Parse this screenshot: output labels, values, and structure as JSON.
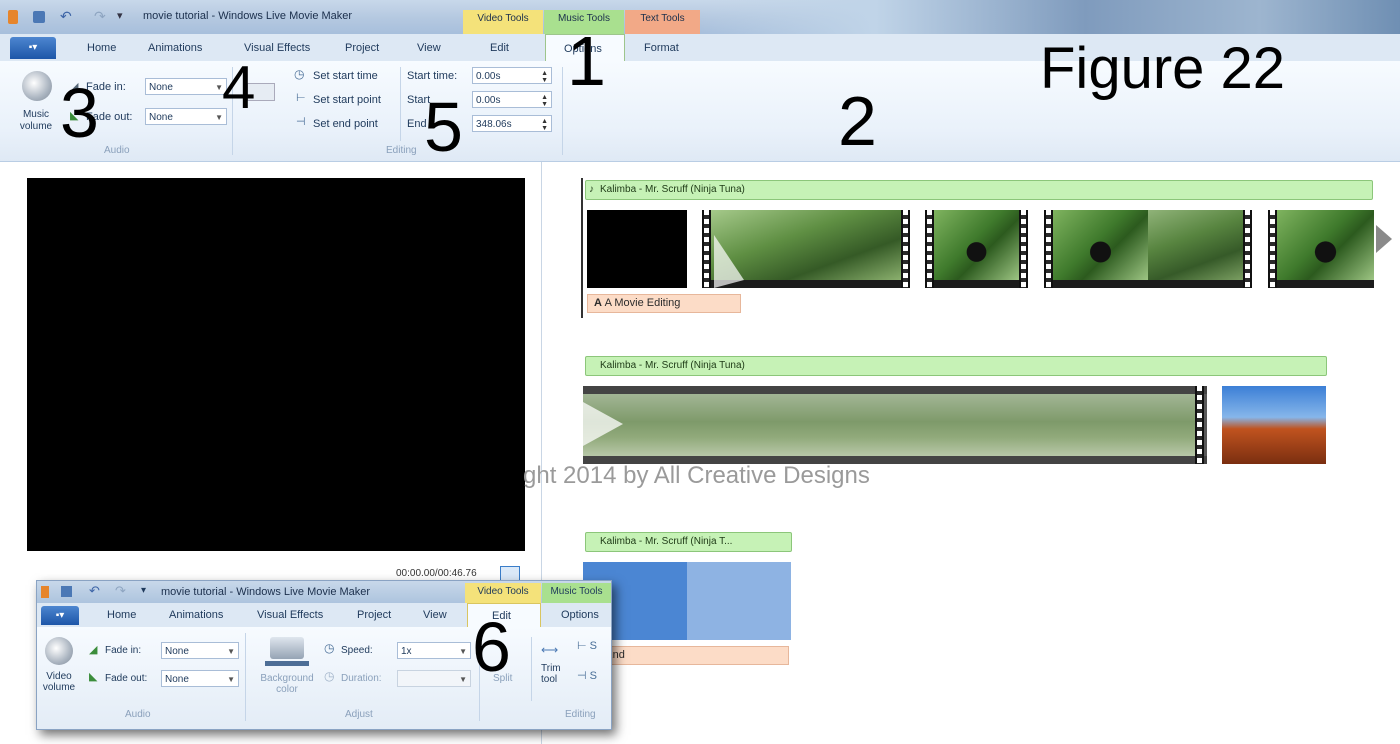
{
  "window": {
    "title": "movie tutorial - Windows Live Movie Maker",
    "context_tabs": {
      "video_tools": "Video Tools",
      "music_tools": "Music Tools",
      "text_tools": "Text Tools"
    }
  },
  "ribbon_tabs": [
    "Home",
    "Animations",
    "Visual Effects",
    "Project",
    "View",
    "Edit",
    "Options",
    "Format"
  ],
  "file_button": "▪▾",
  "audio_group": {
    "music_volume_label": "Music volume",
    "fade_in_label": "Fade in:",
    "fade_in_value": "None",
    "fade_out_label": "Fade out:",
    "fade_out_value": "None",
    "group_label": "Audio"
  },
  "editing_group": {
    "set_start_time": "Set start time",
    "set_start_point": "Set start point",
    "set_end_point": "Set end point",
    "start_time_label": "Start time:",
    "start_time_value": "0.00s",
    "start_point_label": "Start",
    "start_point_value": "0.00s",
    "end_point_label": "End",
    "end_point_value": "348.06s",
    "group_label": "Editing"
  },
  "callouts": {
    "c1": "1",
    "c2": "2",
    "c3": "3",
    "c4": "4",
    "c5": "5",
    "c6": "6"
  },
  "figure_label": "Figure 22",
  "watermark": "ght 2014 by All Creative Designs",
  "preview": {
    "timecode": "00:00.00/00:46.76"
  },
  "timeline": {
    "music1": "Kalimba - Mr. Scruff (Ninja Tuna)",
    "text1": "A Movie Editing",
    "music2": "Kalimba - Mr. Scruff (Ninja Tuna)",
    "music3": "Kalimba - Mr. Scruff (Ninja T...",
    "text2": "he End"
  },
  "popup": {
    "title": "movie tutorial - Windows Live Movie Maker",
    "context_tabs": {
      "video_tools": "Video Tools",
      "music_tools": "Music Tools"
    },
    "tabs": [
      "Home",
      "Animations",
      "Visual Effects",
      "Project",
      "View",
      "Edit",
      "Options"
    ],
    "video_volume_label": "Video volume",
    "fade_in_label": "Fade in:",
    "fade_in_value": "None",
    "fade_out_label": "Fade out:",
    "fade_out_value": "None",
    "audio_group": "Audio",
    "background_color": "Background color",
    "speed_label": "Speed:",
    "speed_value": "1x",
    "duration_label": "Duration:",
    "adjust_group": "Adjust",
    "split": "Split",
    "trim_tool": "Trim tool",
    "editing_group": "Editing"
  }
}
